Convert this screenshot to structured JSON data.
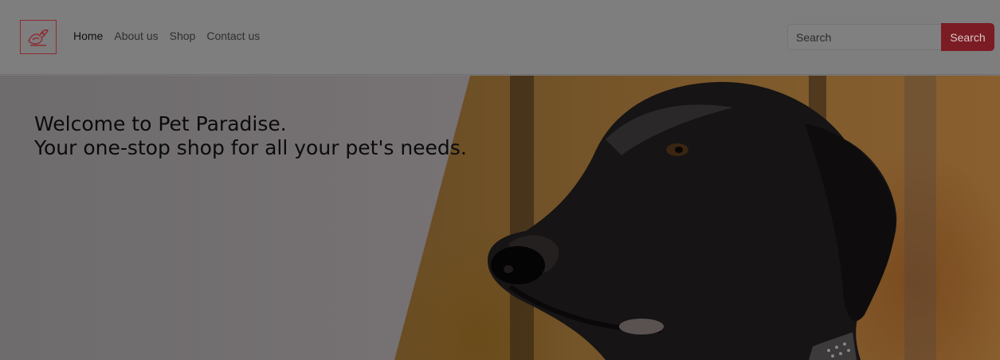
{
  "brand": {
    "logo_icon": "bird-icon",
    "accent": "#c8303a"
  },
  "nav": {
    "items": [
      {
        "label": "Home",
        "active": true
      },
      {
        "label": "About us",
        "active": false
      },
      {
        "label": "Shop",
        "active": false
      },
      {
        "label": "Contact us",
        "active": false
      }
    ]
  },
  "search": {
    "placeholder": "Search",
    "button_label": "Search"
  },
  "hero": {
    "line1": "Welcome to Pet Paradise.",
    "line2": "Your one-stop shop for all your pet's needs.",
    "image": "black-labrador-dog-photo"
  }
}
